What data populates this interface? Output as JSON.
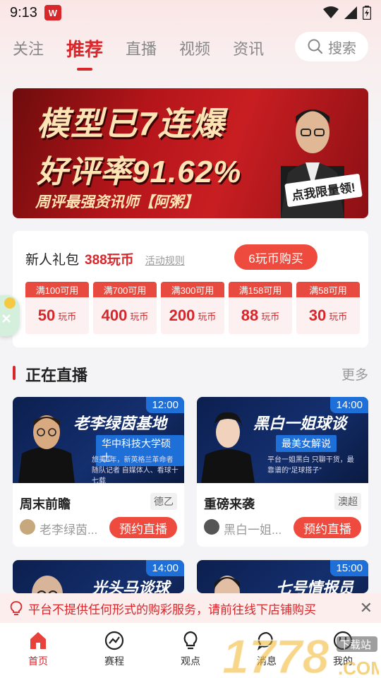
{
  "status_bar": {
    "time": "9:13",
    "app_icon_text": "W"
  },
  "tabs": [
    "关注",
    "推荐",
    "直播",
    "视频",
    "资讯"
  ],
  "active_tab": 1,
  "search": {
    "label": "搜索"
  },
  "banner": {
    "line1": "模型已7连爆",
    "line2": "好评率91.62%",
    "line3": "周评最强资讯师【阿粥】",
    "cta": "点我限量领!",
    "dots": 3,
    "active_dot": 0
  },
  "gift": {
    "title": "新人礼包",
    "amount": "388玩币",
    "rule_link": "活动规则",
    "buy_button": "6玩币购买",
    "coupons": [
      {
        "threshold": "满100可用",
        "value": "50",
        "unit": "玩币"
      },
      {
        "threshold": "满700可用",
        "value": "400",
        "unit": "玩币"
      },
      {
        "threshold": "满300可用",
        "value": "200",
        "unit": "玩币"
      },
      {
        "threshold": "满158可用",
        "value": "88",
        "unit": "玩币"
      },
      {
        "threshold": "满58可用",
        "value": "30",
        "unit": "玩币"
      }
    ]
  },
  "live_section": {
    "title": "正在直播",
    "more": "更多"
  },
  "cards": [
    {
      "time": "12:00",
      "thumb_title": "老李绿茵基地",
      "thumb_badge": "华中科技大学硕士",
      "thumb_desc": "旅美6年，新英格兰革命者随队记者 自媒体人、看球十七载",
      "name": "周末前瞻",
      "league": "德乙",
      "host": "老李绿茵...",
      "button": "预约直播"
    },
    {
      "time": "14:00",
      "thumb_title": "黑白一姐球谈",
      "thumb_badge": "最美女解说",
      "thumb_desc": "平台一姐黑白 只聊干货，最靠谱的“足球搭子”",
      "name": "重磅来袭",
      "league": "澳超",
      "host": "黑白一姐...",
      "button": "预约直播"
    },
    {
      "time": "14:00",
      "thumb_title": "光头马谈球"
    },
    {
      "time": "15:00",
      "thumb_title": "七号情报员"
    }
  ],
  "notice": {
    "text": "平台不提供任何形式的购彩服务，请前往线下店铺购买"
  },
  "nav": [
    "首页",
    "赛程",
    "观点",
    "消息",
    "我的"
  ],
  "active_nav": 0,
  "watermark": {
    "text": "1778",
    "sub": "下载站",
    "suffix": ".COM"
  },
  "colors": {
    "brand_red": "#d8262a",
    "button_red": "#ee4b3e",
    "time_blue": "#1f6fd8"
  }
}
